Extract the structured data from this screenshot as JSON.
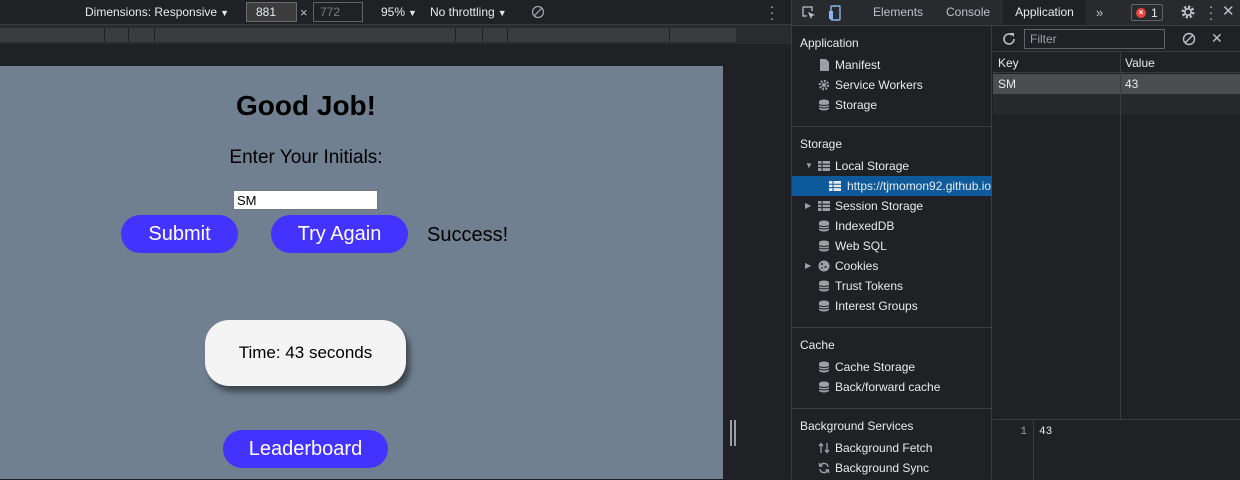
{
  "device_toolbar": {
    "dimensions_label": "Dimensions: Responsive",
    "width_value": "881",
    "separator": "×",
    "height_value": "772",
    "zoom": "95%",
    "throttling": "No throttling"
  },
  "page": {
    "title": "Good Job!",
    "initials_label": "Enter Your Initials:",
    "initials_value": "SM",
    "submit_label": "Submit",
    "try_again_label": "Try Again",
    "status": "Success!",
    "timer_text": "Time: 43 seconds",
    "leaderboard_label": "Leaderboard",
    "background_color": "#708090",
    "button_color": "#4433ff"
  },
  "devtools": {
    "tabs": {
      "elements": "Elements",
      "console": "Console",
      "application": "Application",
      "more": "»"
    },
    "error_count": "1",
    "sidebar": {
      "application_heading": "Application",
      "application_items": [
        "Manifest",
        "Service Workers",
        "Storage"
      ],
      "storage_heading": "Storage",
      "storage_items": {
        "local_storage": "Local Storage",
        "local_storage_origin": "https://tjmomon92.github.io",
        "session_storage": "Session Storage",
        "indexeddb": "IndexedDB",
        "web_sql": "Web SQL",
        "cookies": "Cookies",
        "trust_tokens": "Trust Tokens",
        "interest_groups": "Interest Groups"
      },
      "cache_heading": "Cache",
      "cache_items": [
        "Cache Storage",
        "Back/forward cache"
      ],
      "background_heading": "Background Services",
      "background_items": [
        "Background Fetch",
        "Background Sync"
      ]
    },
    "storage_table": {
      "filter_placeholder": "Filter",
      "columns": [
        "Key",
        "Value"
      ],
      "rows": [
        {
          "key": "SM",
          "value": "43"
        }
      ],
      "preview_line_number": "1",
      "preview_value": "43"
    }
  }
}
